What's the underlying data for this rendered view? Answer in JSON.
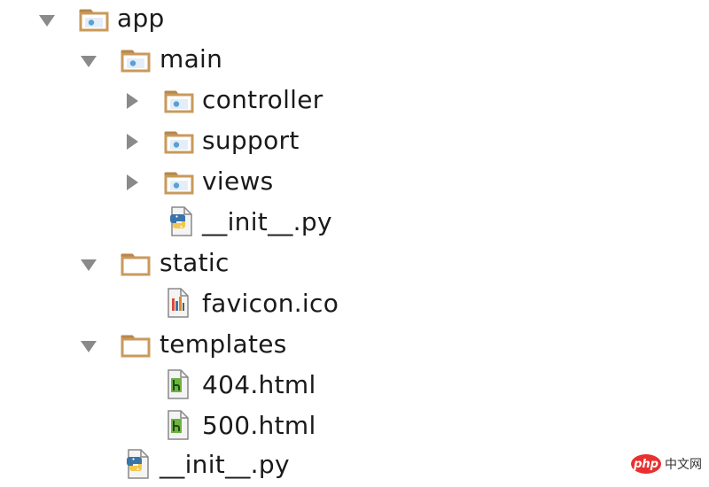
{
  "tree": {
    "app": {
      "label": "app",
      "expanded": true
    },
    "main": {
      "label": "main",
      "expanded": true
    },
    "controller": {
      "label": "controller",
      "expanded": false
    },
    "support": {
      "label": "support",
      "expanded": false
    },
    "views": {
      "label": "views",
      "expanded": false
    },
    "main_init": {
      "label": "__init__.py"
    },
    "static": {
      "label": "static",
      "expanded": true
    },
    "favicon": {
      "label": "favicon.ico"
    },
    "templates": {
      "label": "templates",
      "expanded": true
    },
    "html404": {
      "label": "404.html"
    },
    "html500": {
      "label": "500.html"
    },
    "app_init": {
      "label": "__init__.py"
    }
  },
  "icons": {
    "folder": "folder-icon",
    "package": "python-package-folder-icon",
    "python": "python-file-icon",
    "html": "html-file-icon",
    "image": "image-file-icon",
    "expanded": "triangle-down-icon",
    "collapsed": "triangle-right-icon"
  },
  "colors": {
    "folder_fill": "#d9b57f",
    "folder_stroke": "#b8874a",
    "package_dot": "#5a9fd6",
    "arrow": "#8a8a8a",
    "html_green": "#6cb33f",
    "python_blue": "#3b74a8",
    "python_yellow": "#f2c94c"
  },
  "watermark": {
    "badge": "php",
    "text": "中文网"
  }
}
